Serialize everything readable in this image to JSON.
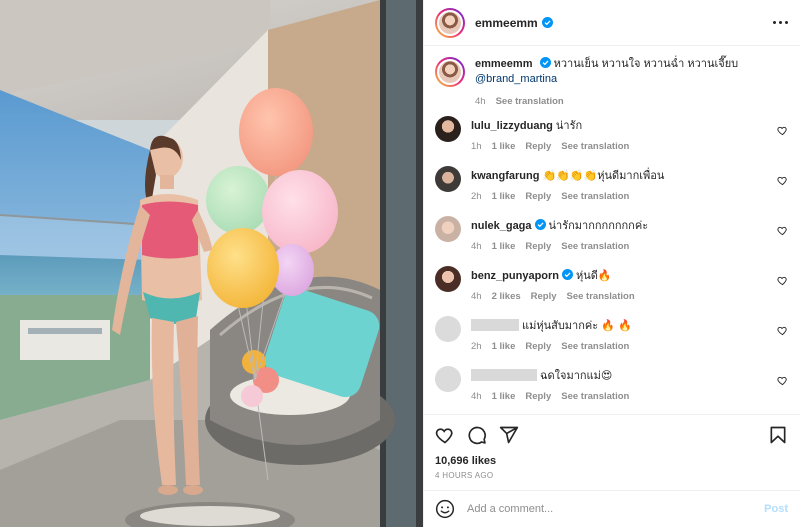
{
  "post": {
    "username": "emmeemm",
    "more_icon": "more-horizontal-icon",
    "verified_color": "#0095f6"
  },
  "caption": {
    "username": "emmeemm",
    "text": "หวานเย็น หวานใจ หวานฉ่ำ หวานเจี๊ยบ",
    "mention": "@brand_martina",
    "time": "4h",
    "see_translation": "See translation"
  },
  "comments": [
    {
      "username": "lulu_lizzyduang",
      "verified": false,
      "redacted": false,
      "text": "น่ารัก",
      "time": "1h",
      "likes": "1 like",
      "reply": "Reply",
      "see_translation": "See translation"
    },
    {
      "username": "kwangfarung",
      "verified": false,
      "redacted": false,
      "text": "👏👏👏👏หุ่นดีมากเพื่อน",
      "time": "2h",
      "likes": "1 like",
      "reply": "Reply",
      "see_translation": "See translation"
    },
    {
      "username": "nulek_gaga",
      "verified": true,
      "redacted": false,
      "text": "น่ารักมากกกกกกกค่ะ",
      "time": "4h",
      "likes": "1 like",
      "reply": "Reply",
      "see_translation": "See translation"
    },
    {
      "username": "benz_punyaporn",
      "verified": true,
      "redacted": false,
      "text": "หุ่นดี🔥",
      "time": "4h",
      "likes": "2 likes",
      "reply": "Reply",
      "see_translation": "See translation"
    },
    {
      "username": "",
      "verified": false,
      "redacted": true,
      "text": "แม่หุ่นสับมากค่ะ 🔥 🔥",
      "time": "2h",
      "likes": "1 like",
      "reply": "Reply",
      "see_translation": "See translation"
    },
    {
      "username": "",
      "verified": false,
      "redacted": true,
      "text": "ฉดใจมากแม่😍",
      "time": "4h",
      "likes": "1 like",
      "reply": "Reply",
      "see_translation": "See translation"
    }
  ],
  "footer": {
    "like_icon": "heart-icon",
    "comment_icon": "comment-icon",
    "share_icon": "share-icon",
    "save_icon": "bookmark-icon",
    "likes": "10,696 likes",
    "time_ago": "4 HOURS AGO"
  },
  "add_comment": {
    "placeholder": "Add a comment...",
    "post_label": "Post",
    "emoji_icon": "emoji-icon"
  },
  "photo": {
    "description_colors": {
      "sky": "#7fb4dc",
      "sea": "#3d8fb4",
      "bikini_top": "#e55a76",
      "bikini_bottom": "#4fb6b0",
      "pillow": "#6cd3d0"
    }
  }
}
